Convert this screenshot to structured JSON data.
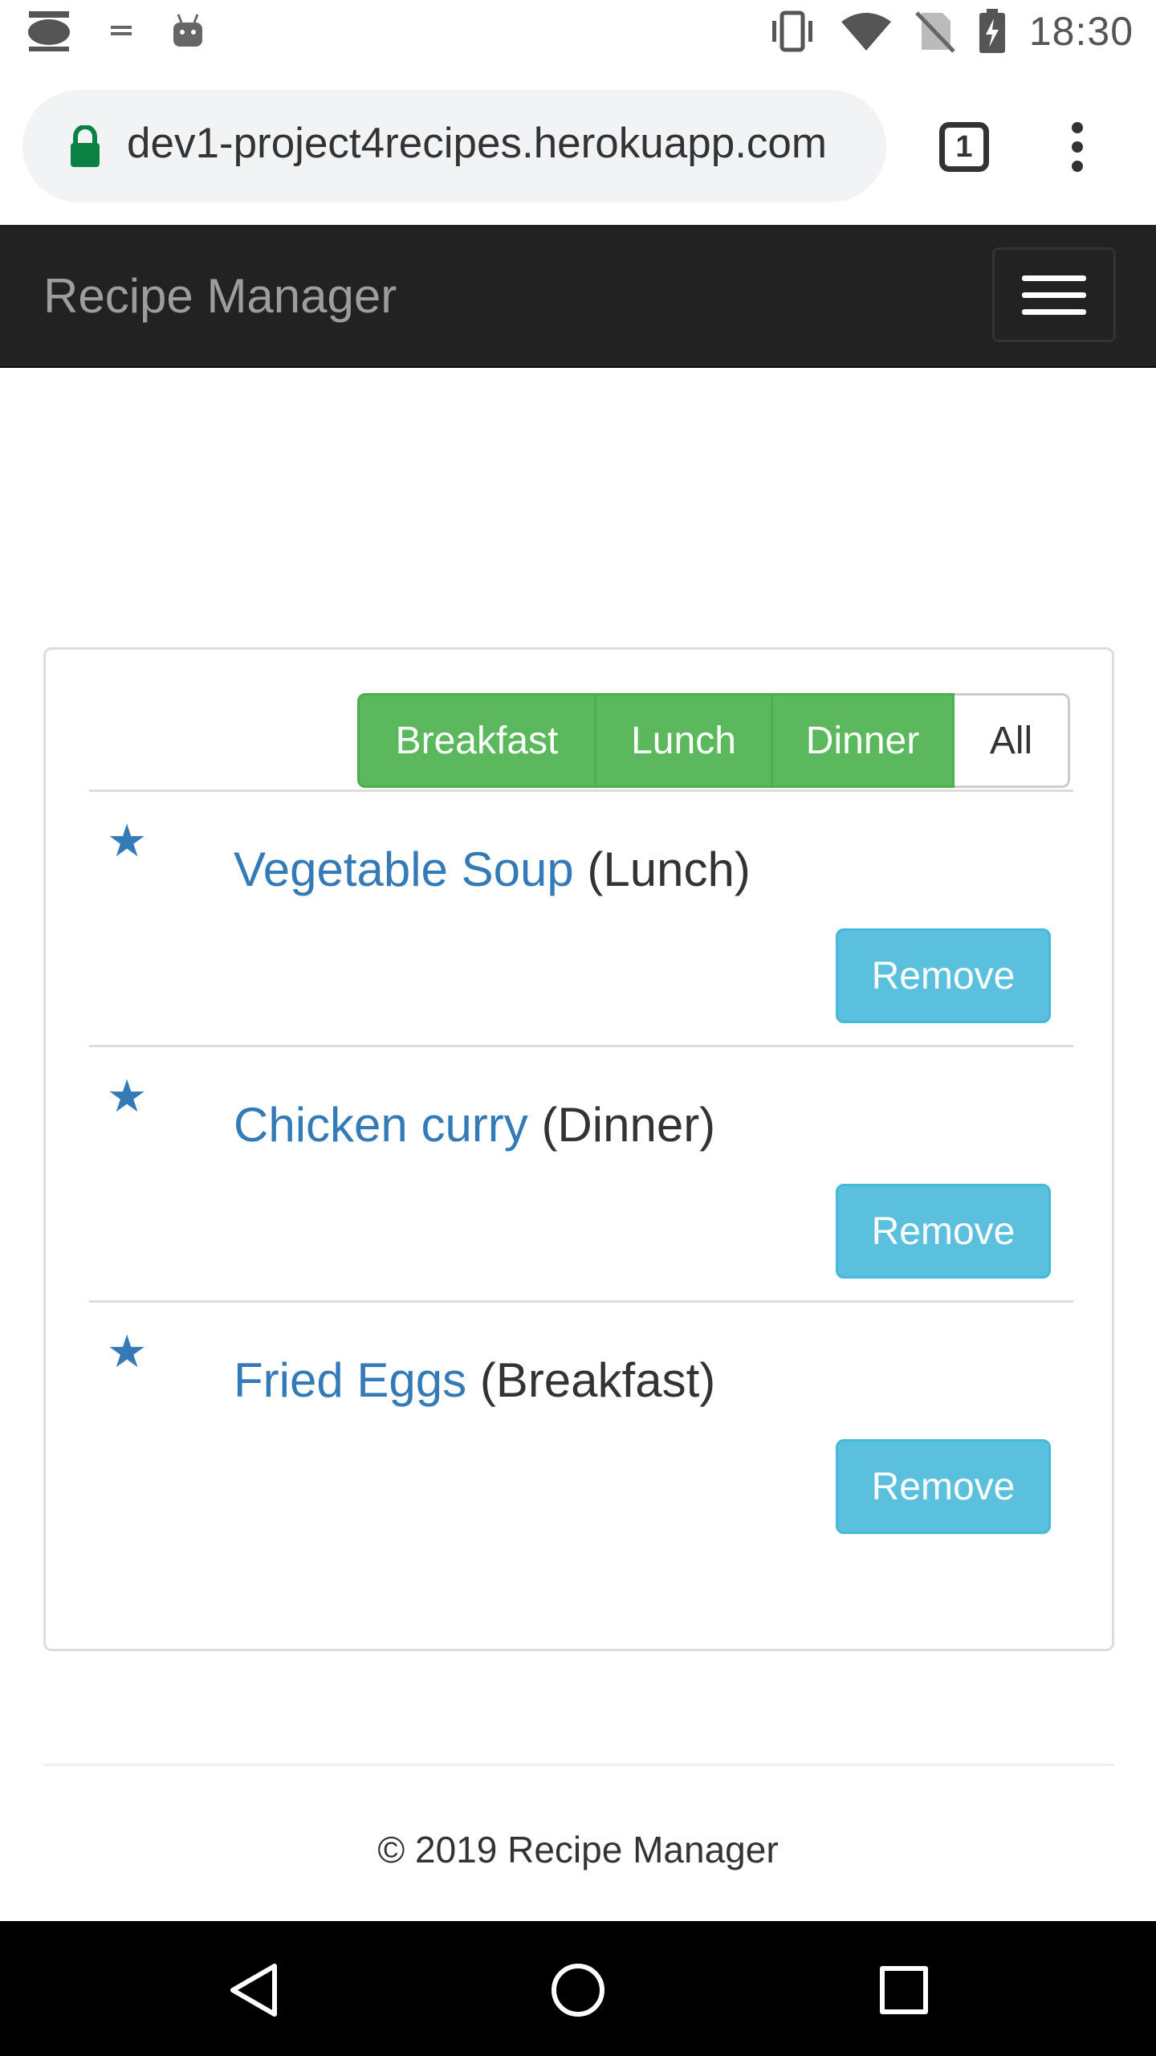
{
  "status_bar": {
    "time": "18:30",
    "left_icons": [
      "keyboard-icon",
      "usb-debug-icon",
      "android-icon"
    ],
    "right_icons": [
      "vibrate-icon",
      "wifi-icon",
      "no-sim-icon",
      "battery-charging-icon"
    ]
  },
  "browser": {
    "url": "dev1-project4recipes.herokuapp.com",
    "tab_count": "1"
  },
  "navbar": {
    "brand": "Recipe Manager"
  },
  "filters": [
    {
      "label": "Breakfast",
      "active": true
    },
    {
      "label": "Lunch",
      "active": true
    },
    {
      "label": "Dinner",
      "active": true
    },
    {
      "label": "All",
      "active": false
    }
  ],
  "recipes": [
    {
      "name": "Vegetable Soup",
      "category": "(Lunch)",
      "remove_label": "Remove"
    },
    {
      "name": "Chicken curry",
      "category": "(Dinner)",
      "remove_label": "Remove"
    },
    {
      "name": "Fried Eggs",
      "category": "(Breakfast)",
      "remove_label": "Remove"
    }
  ],
  "footer": {
    "text": "© 2019 Recipe Manager"
  },
  "colors": {
    "navbar_bg": "#222222",
    "filter_active": "#5cb85c",
    "remove_button": "#5bc0de",
    "link": "#337ab7"
  }
}
